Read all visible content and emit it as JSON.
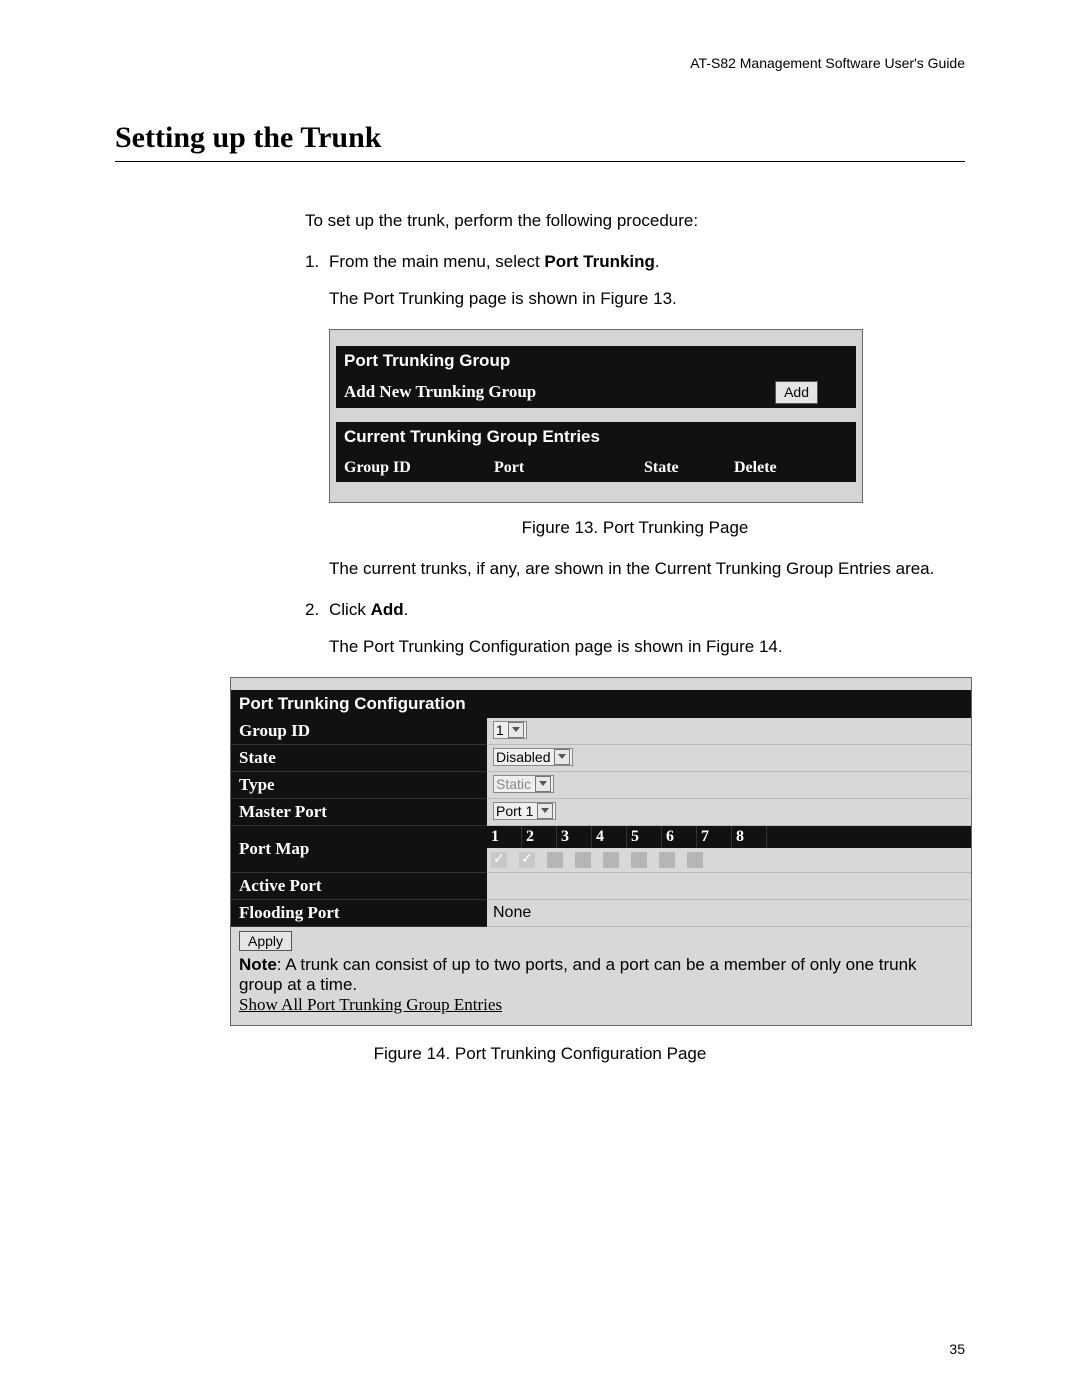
{
  "doc_header": "AT-S82 Management Software User's Guide",
  "section_title": "Setting up the Trunk",
  "intro": "To set up the trunk, perform the following procedure:",
  "step1_num": "1.",
  "step1_prefix": "From the main menu, select ",
  "step1_bold": "Port Trunking",
  "step1_suffix": ".",
  "step1_after": "The Port Trunking page is shown in Figure 13.",
  "fig13": {
    "title": "Port Trunking Group",
    "add_row_label": "Add New Trunking Group",
    "add_btn": "Add",
    "entries_title": "Current Trunking Group Entries",
    "cols": {
      "c1": "Group ID",
      "c2": "Port",
      "c3": "State",
      "c4": "Delete"
    },
    "caption": "Figure 13. Port Trunking Page"
  },
  "after_fig13": "The current trunks, if any, are shown in the Current Trunking Group Entries area.",
  "step2_num": "2.",
  "step2_prefix": "Click ",
  "step2_bold": "Add",
  "step2_suffix": ".",
  "step2_after": "The Port Trunking Configuration page is shown in Figure 14.",
  "fig14": {
    "title": "Port Trunking Configuration",
    "rows": {
      "group_id": {
        "label": "Group ID",
        "value": "1"
      },
      "state": {
        "label": "State",
        "value": "Disabled"
      },
      "type": {
        "label": "Type",
        "value": "Static"
      },
      "master_port": {
        "label": "Master Port",
        "value": "Port 1"
      },
      "port_map": {
        "label": "Port Map"
      },
      "active_port": {
        "label": "Active Port",
        "value": ""
      },
      "flooding_port": {
        "label": "Flooding Port",
        "value": "None"
      }
    },
    "port_numbers": [
      "1",
      "2",
      "3",
      "4",
      "5",
      "6",
      "7",
      "8"
    ],
    "port_checked": [
      true,
      true,
      false,
      false,
      false,
      false,
      false,
      false
    ],
    "apply_btn": "Apply",
    "note_bold": "Note",
    "note_text": ": A trunk can consist of up to two ports, and a port can be a member of only one trunk group at a time.",
    "link": "Show All Port Trunking Group Entries",
    "caption": "Figure 14. Port Trunking Configuration Page"
  },
  "page_number": "35"
}
